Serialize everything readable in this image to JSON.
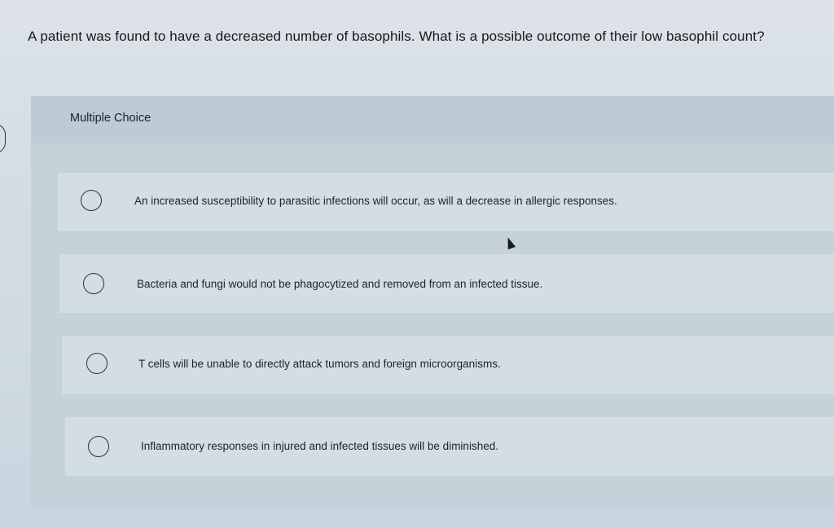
{
  "question": {
    "text": "A patient was found to have a decreased number of basophils. What is a possible outcome of their low basophil count?"
  },
  "quiz": {
    "type_label": "Multiple Choice",
    "options": [
      {
        "label": "An increased susceptibility to parasitic infections will occur, as will a decrease in allergic responses.",
        "selected": false
      },
      {
        "label": "Bacteria and fungi would not be phagocytized and removed from an infected tissue.",
        "selected": false
      },
      {
        "label": "T cells will be unable to directly attack tumors and foreign microorganisms.",
        "selected": false
      },
      {
        "label": "Inflammatory responses in injured and infected tissues will be diminished.",
        "selected": false
      }
    ]
  },
  "colors": {
    "background": "#d4dde4",
    "panel": "#c6d2da",
    "option_row": "#d2dde4",
    "text": "#1b1f24"
  },
  "icons": {
    "radio": "radio-unchecked-icon",
    "cursor": "mouse-pointer-icon"
  }
}
